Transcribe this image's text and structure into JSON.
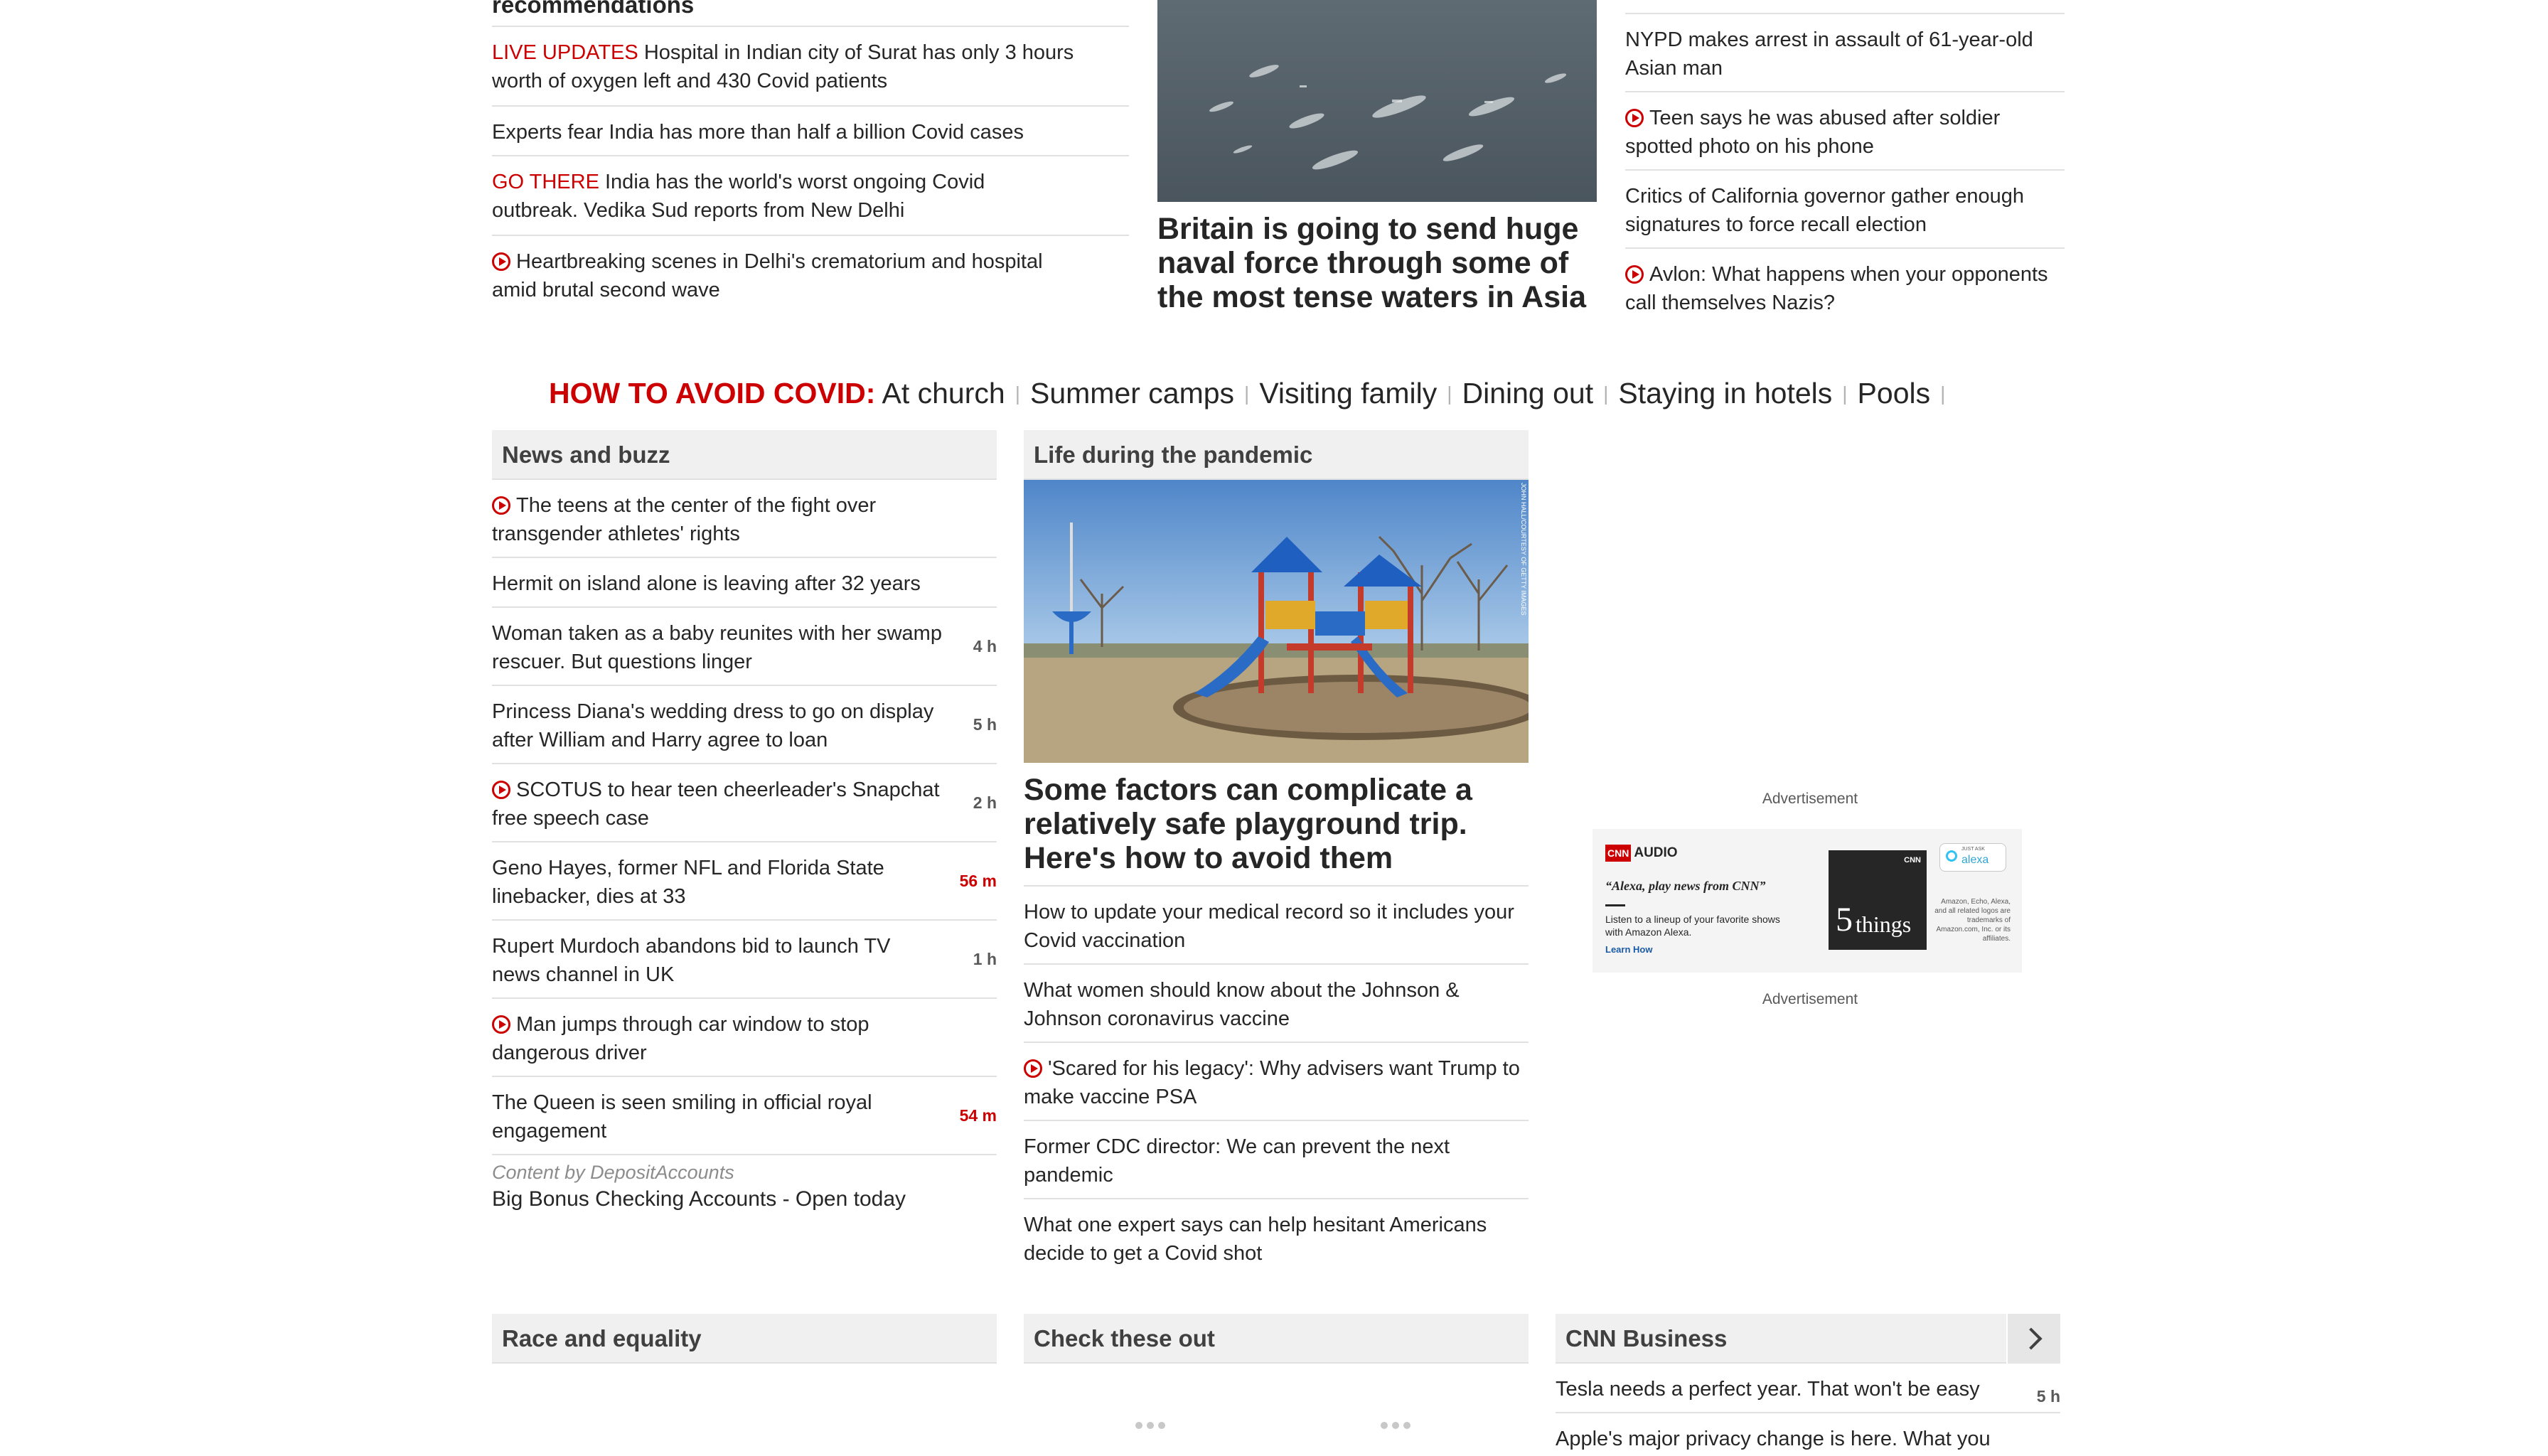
{
  "top_left": {
    "heading": "recommendations",
    "items": [
      {
        "label": "LIVE UPDATES",
        "text": "Hospital in Indian city of Surat has only 3 hours worth of oxygen left and 430 Covid patients"
      },
      {
        "label": "",
        "text": "Experts fear India has more than half a billion Covid cases"
      },
      {
        "label": "GO THERE",
        "text": "India has the world's worst ongoing Covid outbreak. Vedika Sud reports from New Delhi"
      },
      {
        "label": "",
        "text": "Heartbreaking scenes in Delhi's crematorium and hospital amid brutal second wave",
        "video": true
      }
    ]
  },
  "top_center": {
    "headline": "Britain is going to send huge naval force through some of the most tense waters in Asia"
  },
  "top_right": {
    "items": [
      {
        "text": "NYPD makes arrest in assault of 61-year-old Asian man"
      },
      {
        "text": "Teen says he was abused after soldier spotted photo on his phone",
        "video": true
      },
      {
        "text": "Critics of California governor gather enough signatures to force recall election"
      },
      {
        "text": "Avlon: What happens when your opponents call themselves Nazis?",
        "video": true
      }
    ]
  },
  "how_to_avoid": {
    "label": "HOW TO AVOID COVID:",
    "links": [
      "At church",
      "Summer camps",
      "Visiting family",
      "Dining out",
      "Staying in hotels",
      "Pools"
    ],
    "separator": "|"
  },
  "news_buzz": {
    "title": "News and buzz",
    "items": [
      {
        "text": "The teens at the center of the fight over transgender athletes' rights",
        "video": true,
        "time": ""
      },
      {
        "text": "Hermit on island alone is leaving after 32 years",
        "time": ""
      },
      {
        "text": "Woman taken as a baby reunites with her swamp rescuer. But questions linger",
        "time": "4 h"
      },
      {
        "text": "Princess Diana's wedding dress to go on display after William and Harry agree to loan",
        "time": "5 h"
      },
      {
        "text": "SCOTUS to hear teen cheerleader's Snapchat free speech case",
        "video": true,
        "time": "2 h"
      },
      {
        "text": "Geno Hayes, former NFL and Florida State linebacker, dies at 33",
        "time": "56 m",
        "time_color": "#cc0000"
      },
      {
        "text": "Rupert Murdoch abandons bid to launch TV news channel in UK",
        "time": "1 h"
      },
      {
        "text": "Man jumps through car window to stop dangerous driver",
        "video": true,
        "time": ""
      },
      {
        "text": "The Queen is seen smiling in official royal engagement",
        "time": "54 m",
        "time_color": "#cc0000"
      }
    ],
    "sponsor_label": "Content by DepositAccounts",
    "sponsor_text": "Big Bonus Checking Accounts - Open today"
  },
  "pandemic": {
    "title": "Life during the pandemic",
    "photo_credit": "JOHN HALL/COURTESY OF GETTY IMAGES",
    "headline": "Some factors can complicate a relatively safe playground trip. Here's how to avoid them",
    "items": [
      {
        "text": "How to update your medical record so it includes your Covid vaccination"
      },
      {
        "text": "What women should know about the Johnson & Johnson coronavirus vaccine"
      },
      {
        "text": "'Scared for his legacy': Why advisers want Trump to make vaccine PSA",
        "video": true
      },
      {
        "text": "Former CDC director: We can prevent the next pandemic"
      },
      {
        "text": "What one expert says can help hesitant Americans decide to get a Covid shot"
      }
    ]
  },
  "ad": {
    "label_top": "Advertisement",
    "label_bottom": "Advertisement",
    "brand": "CNN",
    "audio": "AUDIO",
    "quote": "“Alexa, play news from CNN”",
    "body": "Listen to a lineup of your favorite shows with Amazon Alexa.",
    "cta": "Learn How",
    "badge_small": "JUST ASK",
    "badge": "alexa",
    "show_number": "5",
    "show_name": "things",
    "disclaimer": "Amazon, Echo, Alexa, and all related logos are trademarks of Amazon.com, Inc. or its affiliates."
  },
  "bottom": {
    "race_title": "Race and equality",
    "check_title": "Check these out",
    "business_title": "CNN Business",
    "business_items": [
      {
        "text": "Tesla needs a perfect year. That won't be easy",
        "time": "5 h"
      },
      {
        "text": "Apple's major privacy change is here. What you",
        "time": ""
      }
    ]
  },
  "colors": {
    "accent_red": "#cc0000",
    "zone_bg": "#f0f0f0",
    "text": "#262626"
  }
}
